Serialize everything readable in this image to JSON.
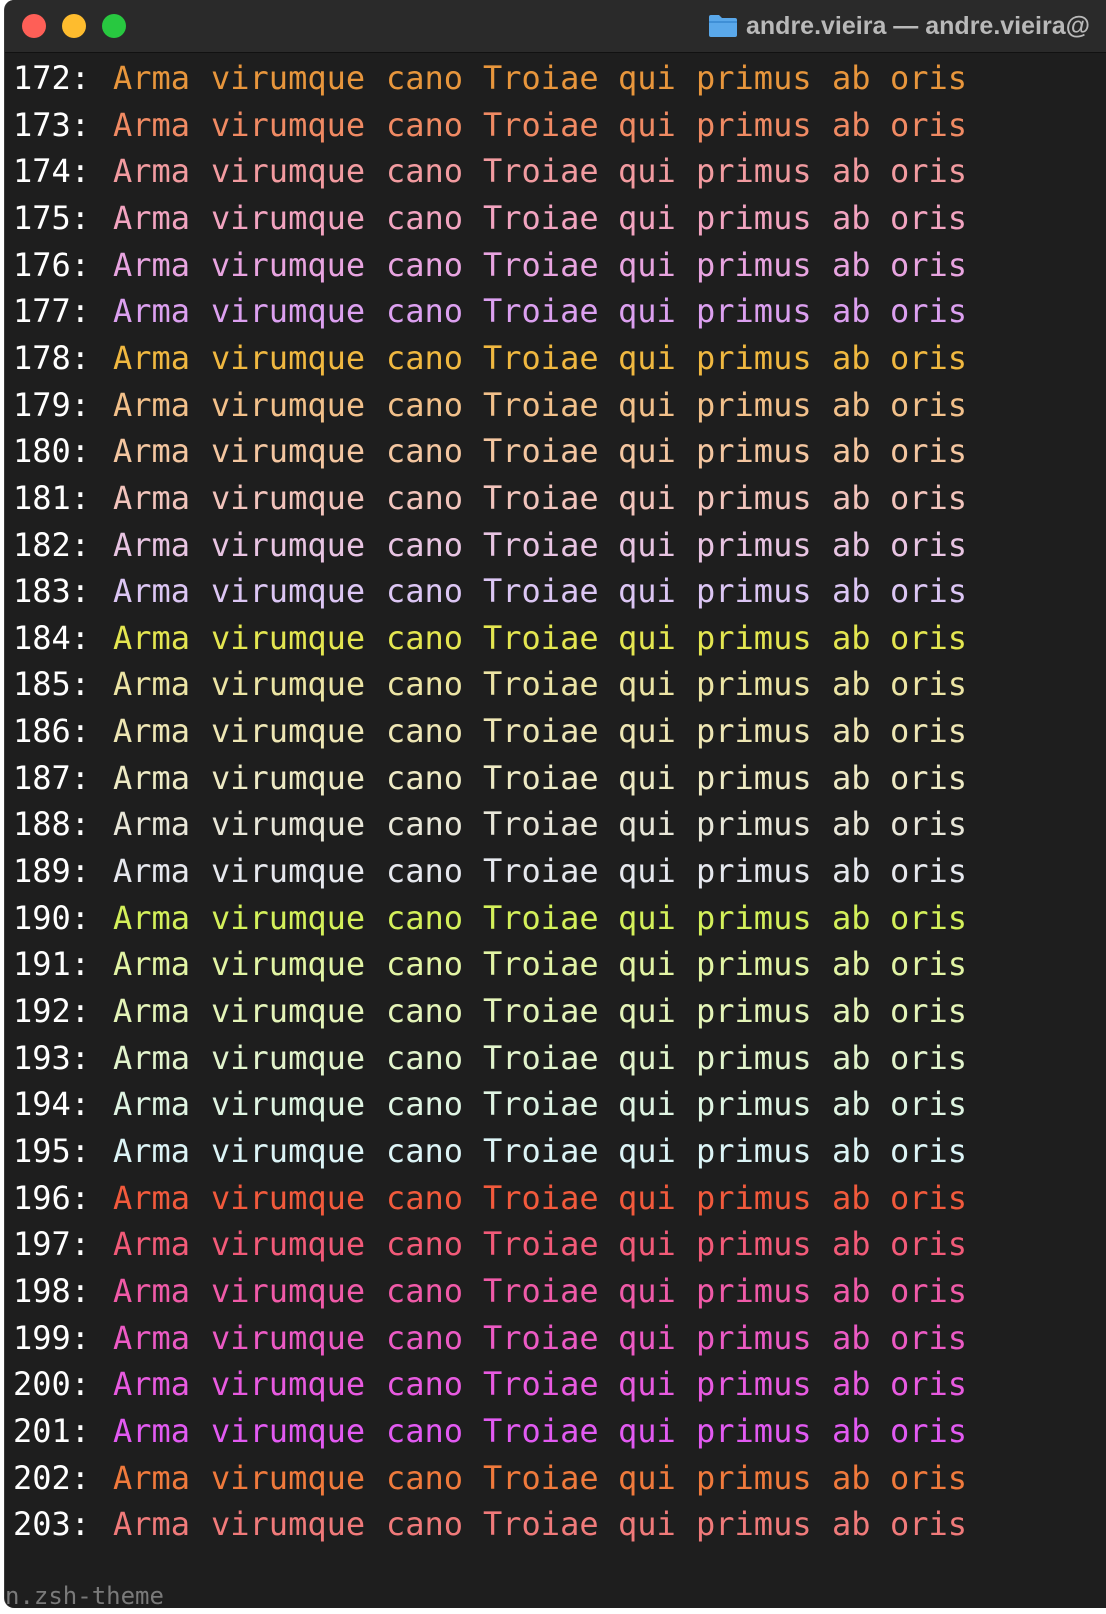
{
  "window": {
    "title": "andre.vieira — andre.vieira@",
    "folder_icon": "folder-icon"
  },
  "words": [
    "Arma",
    "virumque",
    "cano",
    "Troiae",
    "qui",
    "primus",
    "ab",
    "oris"
  ],
  "lines": [
    {
      "num": "172:",
      "color": "#e8963c"
    },
    {
      "num": "173:",
      "color": "#f08a63"
    },
    {
      "num": "174:",
      "color": "#f29ba0"
    },
    {
      "num": "175:",
      "color": "#f2a4c0"
    },
    {
      "num": "176:",
      "color": "#e8a4e0"
    },
    {
      "num": "177:",
      "color": "#dca0f0"
    },
    {
      "num": "178:",
      "color": "#f0b840"
    },
    {
      "num": "179:",
      "color": "#f2c08a"
    },
    {
      "num": "180:",
      "color": "#f4c6a0"
    },
    {
      "num": "181:",
      "color": "#f2c4bc"
    },
    {
      "num": "182:",
      "color": "#e8c4e2"
    },
    {
      "num": "183:",
      "color": "#dcc6f4"
    },
    {
      "num": "184:",
      "color": "#e4e650"
    },
    {
      "num": "185:",
      "color": "#ece4a4"
    },
    {
      "num": "186:",
      "color": "#eee6b4"
    },
    {
      "num": "187:",
      "color": "#eeeac4"
    },
    {
      "num": "188:",
      "color": "#e8e6d8"
    },
    {
      "num": "189:",
      "color": "#e6e8ee"
    },
    {
      "num": "190:",
      "color": "#d4f05a"
    },
    {
      "num": "191:",
      "color": "#e2f4a4"
    },
    {
      "num": "192:",
      "color": "#e4f4b8"
    },
    {
      "num": "193:",
      "color": "#e2f4cc"
    },
    {
      "num": "194:",
      "color": "#dff4e2"
    },
    {
      "num": "195:",
      "color": "#dcf4f6"
    },
    {
      "num": "196:",
      "color": "#f25a3c"
    },
    {
      "num": "197:",
      "color": "#f25a78"
    },
    {
      "num": "198:",
      "color": "#f05aa8"
    },
    {
      "num": "199:",
      "color": "#ec5ac4"
    },
    {
      "num": "200:",
      "color": "#e85ae0"
    },
    {
      "num": "201:",
      "color": "#e25af2"
    },
    {
      "num": "202:",
      "color": "#f07a3c"
    },
    {
      "num": "203:",
      "color": "#f07a7a"
    }
  ],
  "footer": "n.zsh-theme"
}
